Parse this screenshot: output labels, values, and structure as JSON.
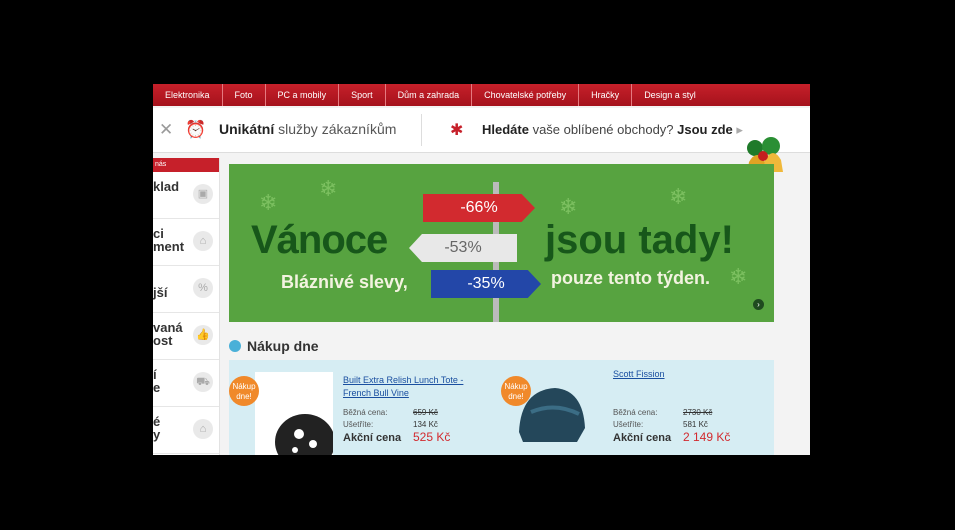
{
  "nav": {
    "items": [
      "Elektronika",
      "Foto",
      "PC a mobily",
      "Sport",
      "Dům a zahrada",
      "Chovatelské potřeby",
      "Hračky",
      "Design a styl"
    ]
  },
  "service_bar": {
    "unique_bold": "Unikátní",
    "unique_rest": " služby zákazníkům",
    "find_lead": "Hledáte",
    "find_mid": " vaše oblíbené obchody?",
    "find_strong": " Jsou zde",
    "find_arrow": "▸"
  },
  "sidebar": {
    "header": "nás",
    "items": [
      {
        "label": "klad",
        "icon": "box-icon"
      },
      {
        "label": "ci\nment",
        "icon": "basket-icon"
      },
      {
        "label": "jší",
        "icon": "percent-icon"
      },
      {
        "label": "vaná\nost",
        "icon": "thumbs-up-icon"
      },
      {
        "label": "í\ne",
        "icon": "truck-icon"
      },
      {
        "label": "é\ny",
        "icon": "home-icon"
      }
    ]
  },
  "banner": {
    "title_left": "Vánoce",
    "title_right": "jsou tady!",
    "sub_left": "Bláznivé slevy,",
    "sub_right": "pouze tento týden.",
    "sign_red": "-66%",
    "sign_white": "-53%",
    "sign_blue": "-35%",
    "colors": {
      "bg": "#57a340",
      "title": "#17571a",
      "red": "#d22a2f",
      "blue": "#2347a8"
    }
  },
  "deals": {
    "title": "Nákup dne",
    "badge": "Nákup dne!",
    "products": [
      {
        "name": "Built Extra Relish Lunch Tote - French Bull Vine",
        "regular_label": "Běžná cena:",
        "regular_price": "659 Kč",
        "save_label": "Ušetříte:",
        "save_value": "134 Kč",
        "action_label": "Akční cena",
        "action_price": "525 Kč"
      },
      {
        "name": "Scott Fission",
        "regular_label": "Běžná cena:",
        "regular_price": "2730 Kč",
        "save_label": "Ušetříte:",
        "save_value": "581 Kč",
        "action_label": "Akční cena",
        "action_price": "2 149 Kč"
      }
    ]
  }
}
